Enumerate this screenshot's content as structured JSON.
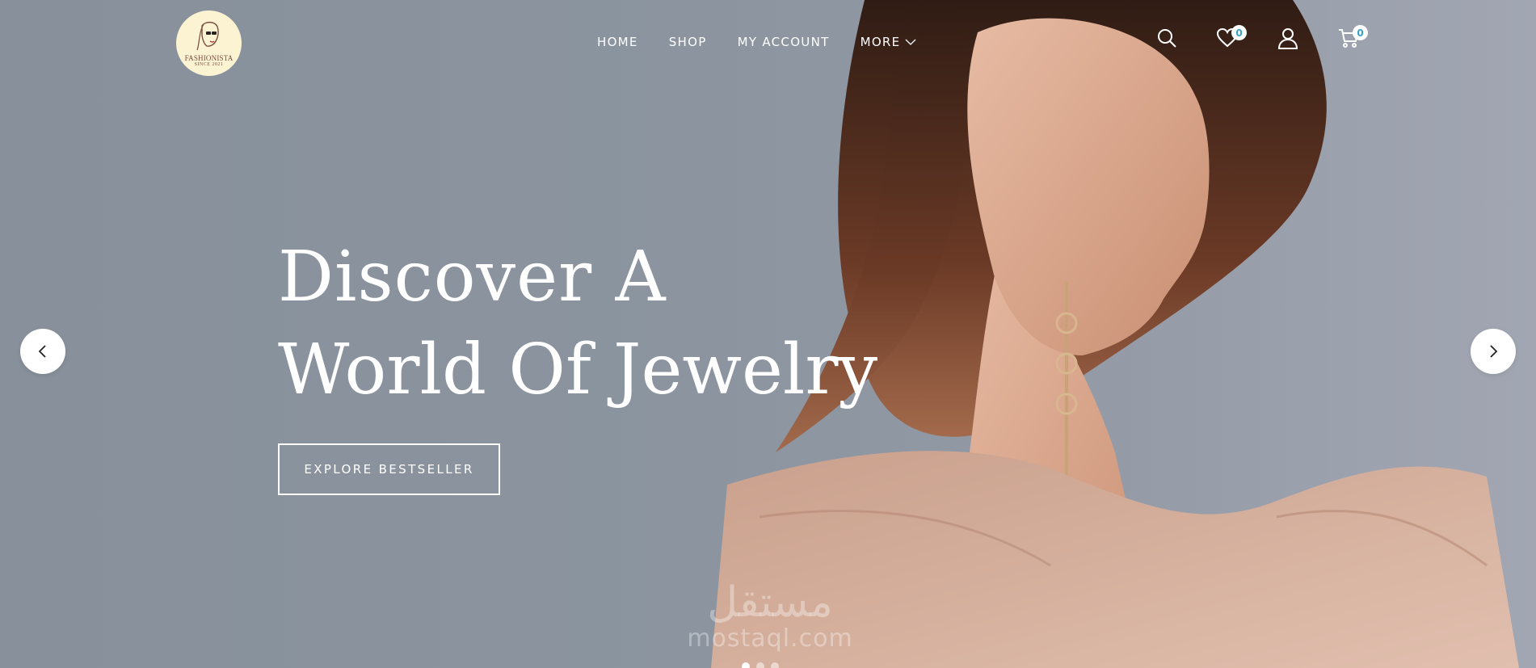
{
  "header": {
    "logo": {
      "brand": "FASHIONISTA",
      "since": "SINCE 2021"
    },
    "nav": [
      {
        "label": "HOME"
      },
      {
        "label": "SHOP"
      },
      {
        "label": "MY ACCOUNT"
      },
      {
        "label": "MORE"
      }
    ],
    "icons": {
      "search": "search-icon",
      "wishlist": "heart-icon",
      "account": "user-icon",
      "cart": "cart-icon"
    },
    "wishlist_count": "0",
    "cart_count": "0"
  },
  "hero": {
    "headline_line1": "Discover A",
    "headline_line2": "World Of Jewelry",
    "cta_label": "EXPLORE BESTSELLER"
  },
  "slider": {
    "prev_icon": "chevron-left-icon",
    "next_icon": "chevron-right-icon",
    "slide_count": 3,
    "active_slide": 1
  },
  "watermark": {
    "arabic": "مستقل",
    "latin": "mostaql.com"
  },
  "colors": {
    "background": "#8a939e",
    "text": "#ffffff",
    "badge_text": "#3aa0c4",
    "logo_bg": "#fbf3d2"
  }
}
